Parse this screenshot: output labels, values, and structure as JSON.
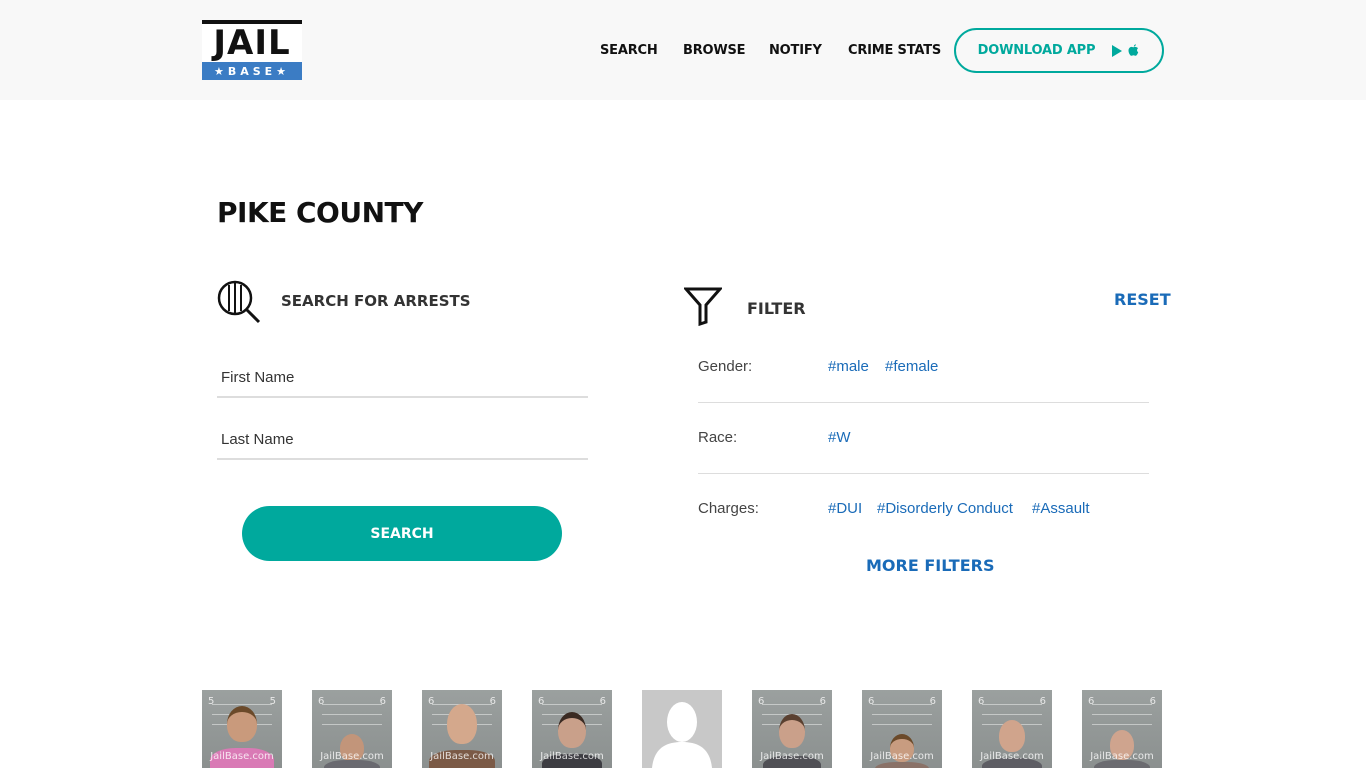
{
  "header": {
    "logo_top": "JAIL",
    "logo_bottom": "★BASE★",
    "nav": [
      "SEARCH",
      "BROWSE",
      "NOTIFY",
      "CRIME STATS"
    ],
    "download_label": "DOWNLOAD APP"
  },
  "page_title": "PIKE COUNTY",
  "search": {
    "title": "SEARCH FOR ARRESTS",
    "first_name_placeholder": "First Name",
    "last_name_placeholder": "Last Name",
    "button_label": "SEARCH"
  },
  "filter": {
    "title": "FILTER",
    "reset_label": "RESET",
    "gender_label": "Gender:",
    "gender_tags": [
      "#male",
      "#female"
    ],
    "race_label": "Race:",
    "race_tags": [
      "#W"
    ],
    "charges_label": "Charges:",
    "charges_tags": [
      "#DUI",
      "#Disorderly Conduct",
      "#Assault"
    ],
    "more_filters_label": "MORE FILTERS"
  },
  "mugshots": {
    "watermark": "JailBase.com",
    "count": 9
  },
  "colors": {
    "accent_teal": "#00a99d",
    "link_blue": "#1a6bb8",
    "logo_blue": "#3b7cc4",
    "header_bg": "#f8f8f8"
  }
}
